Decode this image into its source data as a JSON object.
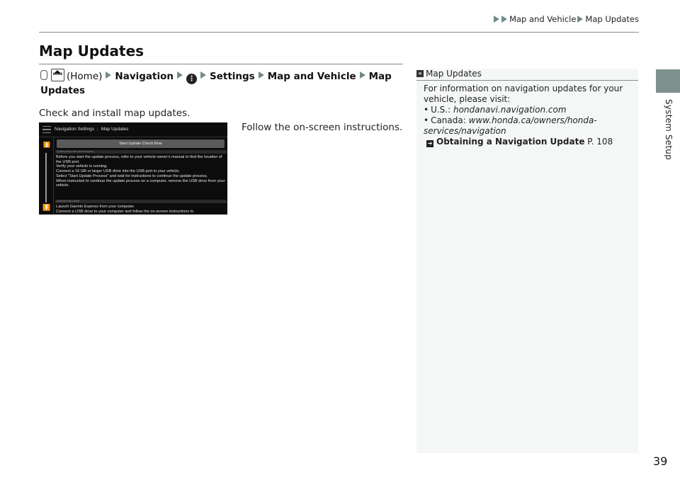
{
  "header": {
    "breadcrumb": [
      "Map and Vehicle",
      "Map Updates"
    ]
  },
  "side_tab": {
    "label": "System Setup",
    "color": "#7f908f"
  },
  "title": "Map Updates",
  "path": {
    "home_label": "(Home)",
    "steps": [
      "Navigation",
      "Settings",
      "Map and Vehicle",
      "Map Updates"
    ],
    "menu_icon_glyph": "⋮"
  },
  "description": "Check and install map updates.",
  "instruction": "Follow the on-screen instructions.",
  "screen": {
    "title_left": "Navigation Settings",
    "title_sep": "|",
    "title_right": "Map Updates",
    "button": "Start Update Check Now",
    "section1": "Updating Maps with Garmin Express",
    "lines1": [
      "Before you start the update process, refer to your vehicle owner's manual to find the location of the USB port.",
      "Verify your vehicle is running.",
      "Connect a 16 GB or larger USB drive into the USB port in your vehicle.",
      "Select \"Start Update Process\" and wait for instructions to continue the update process.",
      "When instructed to continue the update process on a computer, remove the USB drive from your vehicle."
    ],
    "section2": "Download Map Update",
    "lines2": [
      "Launch Garmin Express from your computer.",
      "Connect a USB drive to your computer and follow the on-screen instructions to"
    ]
  },
  "note": {
    "heading": "Map Updates",
    "intro": "For information on navigation updates for your vehicle, please visit:",
    "us_label": "U.S.:",
    "us_url": "hondanavi.navigation.com",
    "ca_label": "Canada:",
    "ca_url": "www.honda.ca/owners/honda-services/navigation",
    "xref_title": "Obtaining a Navigation Update",
    "xref_page": "P. 108"
  },
  "page_number": "39"
}
